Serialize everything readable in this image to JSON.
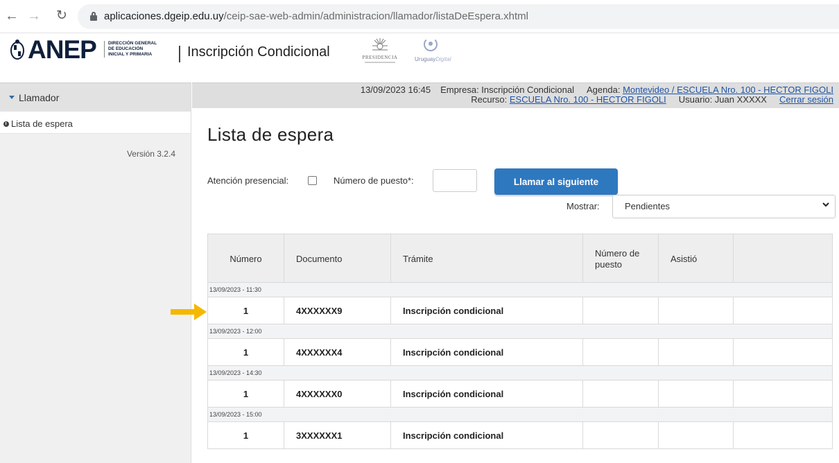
{
  "browser": {
    "url_host": "aplicaciones.dgeip.edu.uy",
    "url_path": "/ceip-sae-web-admin/administracion/llamador/listaDeEspera.xhtml"
  },
  "header": {
    "logo_text": "ANEP",
    "logo_sub": [
      "DIRECCIÓN GENERAL",
      "DE EDUCACIÓN",
      "INICIAL Y PRIMARIA"
    ],
    "title": "Inscripción Condicional",
    "presidencia": "PRESIDENCIA",
    "uy_digital_a": "Uruguay",
    "uy_digital_b": "Digital"
  },
  "sidebar": {
    "section_label": "Llamador",
    "items": [
      {
        "label": "Lista de espera"
      }
    ],
    "version": "Versión 3.2.4"
  },
  "infobar": {
    "datetime": "13/09/2023 16:45",
    "empresa": "Empresa: Inscripción Condicional",
    "agenda_label": "Agenda:",
    "agenda_link": "Montevideo / ESCUELA Nro. 100 - HECTOR FIGOLI",
    "recurso_label": "Recurso:",
    "recurso_link": "ESCUELA Nro. 100 - HECTOR FIGOLI",
    "usuario": "Usuario: Juan XXXXX",
    "logout": "Cerrar sesión"
  },
  "main": {
    "title": "Lista de espera",
    "presencial_label": "Atención presencial:",
    "puesto_label": "Número de puesto*:",
    "puesto_value": "",
    "call_button": "Llamar al siguiente",
    "mostrar_label": "Mostrar:",
    "mostrar_value": "Pendientes"
  },
  "table": {
    "headers": [
      "Número",
      "Documento",
      "Trámite",
      "Número de puesto",
      "Asistió",
      ""
    ],
    "groups": [
      {
        "time": "13/09/2023 - 11:30",
        "row": {
          "numero": "1",
          "documento": "4XXXXXX9",
          "tramite": "Inscripción condicional",
          "puesto": "",
          "asistio": ""
        }
      },
      {
        "time": "13/09/2023 - 12:00",
        "row": {
          "numero": "1",
          "documento": "4XXXXXX4",
          "tramite": "Inscripción condicional",
          "puesto": "",
          "asistio": ""
        }
      },
      {
        "time": "13/09/2023 - 14:30",
        "row": {
          "numero": "1",
          "documento": "4XXXXXX0",
          "tramite": "Inscripción condicional",
          "puesto": "",
          "asistio": ""
        }
      },
      {
        "time": "13/09/2023 - 15:00",
        "row": {
          "numero": "1",
          "documento": "3XXXXXX1",
          "tramite": "Inscripción condicional",
          "puesto": "",
          "asistio": ""
        }
      }
    ]
  },
  "colors": {
    "accent": "#2e78c0",
    "link": "#1f55a6",
    "arrow": "#f5b800"
  },
  "icons": [
    "back-arrow-icon",
    "forward-arrow-icon",
    "reload-icon",
    "lock-icon",
    "caret-down-icon",
    "clock-icon",
    "chevron-down-icon",
    "pointer-arrow-icon"
  ]
}
